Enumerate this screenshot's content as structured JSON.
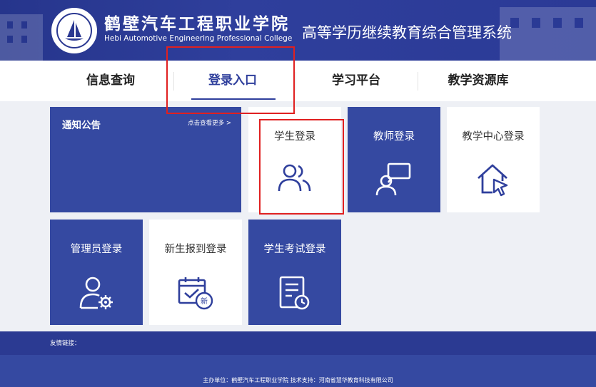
{
  "header": {
    "school_name_cn": "鹤壁汽车工程职业学院",
    "school_name_en": "Hebi Automotive Engineering Professional College",
    "system_title": "高等学历继续教育综合管理系统"
  },
  "nav": {
    "items": [
      {
        "label": "信息查询"
      },
      {
        "label": "登录入口"
      },
      {
        "label": "学习平台"
      },
      {
        "label": "教学资源库"
      }
    ],
    "active_index": 1
  },
  "notice": {
    "title": "通知公告",
    "more_label": "点击查看更多 >"
  },
  "tiles": {
    "student": {
      "label": "学生登录",
      "icon": "users-icon"
    },
    "teacher": {
      "label": "教师登录",
      "icon": "presenter-icon"
    },
    "center": {
      "label": "教学中心登录",
      "icon": "house-cursor-icon"
    },
    "admin": {
      "label": "管理员登录",
      "icon": "user-gear-icon"
    },
    "newstudent": {
      "label": "新生报到登录",
      "icon": "calendar-new-icon"
    },
    "exam": {
      "label": "学生考试登录",
      "icon": "exam-paper-icon"
    }
  },
  "footer": {
    "links_label": "友情链接：",
    "host_text": "主办单位：鹤壁汽车工程职业学院     技术支持：河南省慧华教育科技有限公司"
  },
  "colors": {
    "primary": "#3549a1",
    "header": "#2f3f9c",
    "highlight": "#e02020"
  }
}
